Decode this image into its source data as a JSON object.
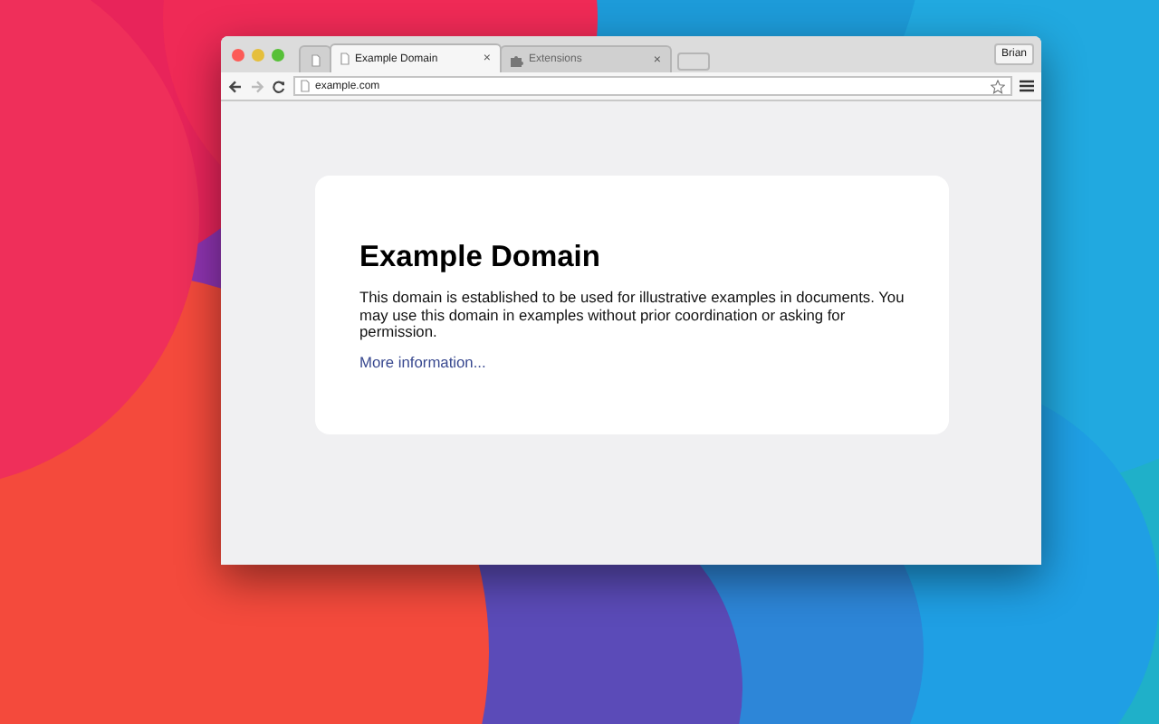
{
  "tabs": [
    {
      "kind": "blank",
      "selected": false
    },
    {
      "kind": "page",
      "label": "Example Domain",
      "close": "×",
      "selected": true
    },
    {
      "kind": "extension",
      "label": "Extensions",
      "close": "×",
      "selected": false
    }
  ],
  "profile": "Brian",
  "address": {
    "value": "example.com"
  },
  "page": {
    "heading": "Example Domain",
    "paragraph": "This domain is established to be used for illustrative examples in documents. You may use this domain in examples without prior coordination or asking for permission.",
    "link": "More information..."
  }
}
